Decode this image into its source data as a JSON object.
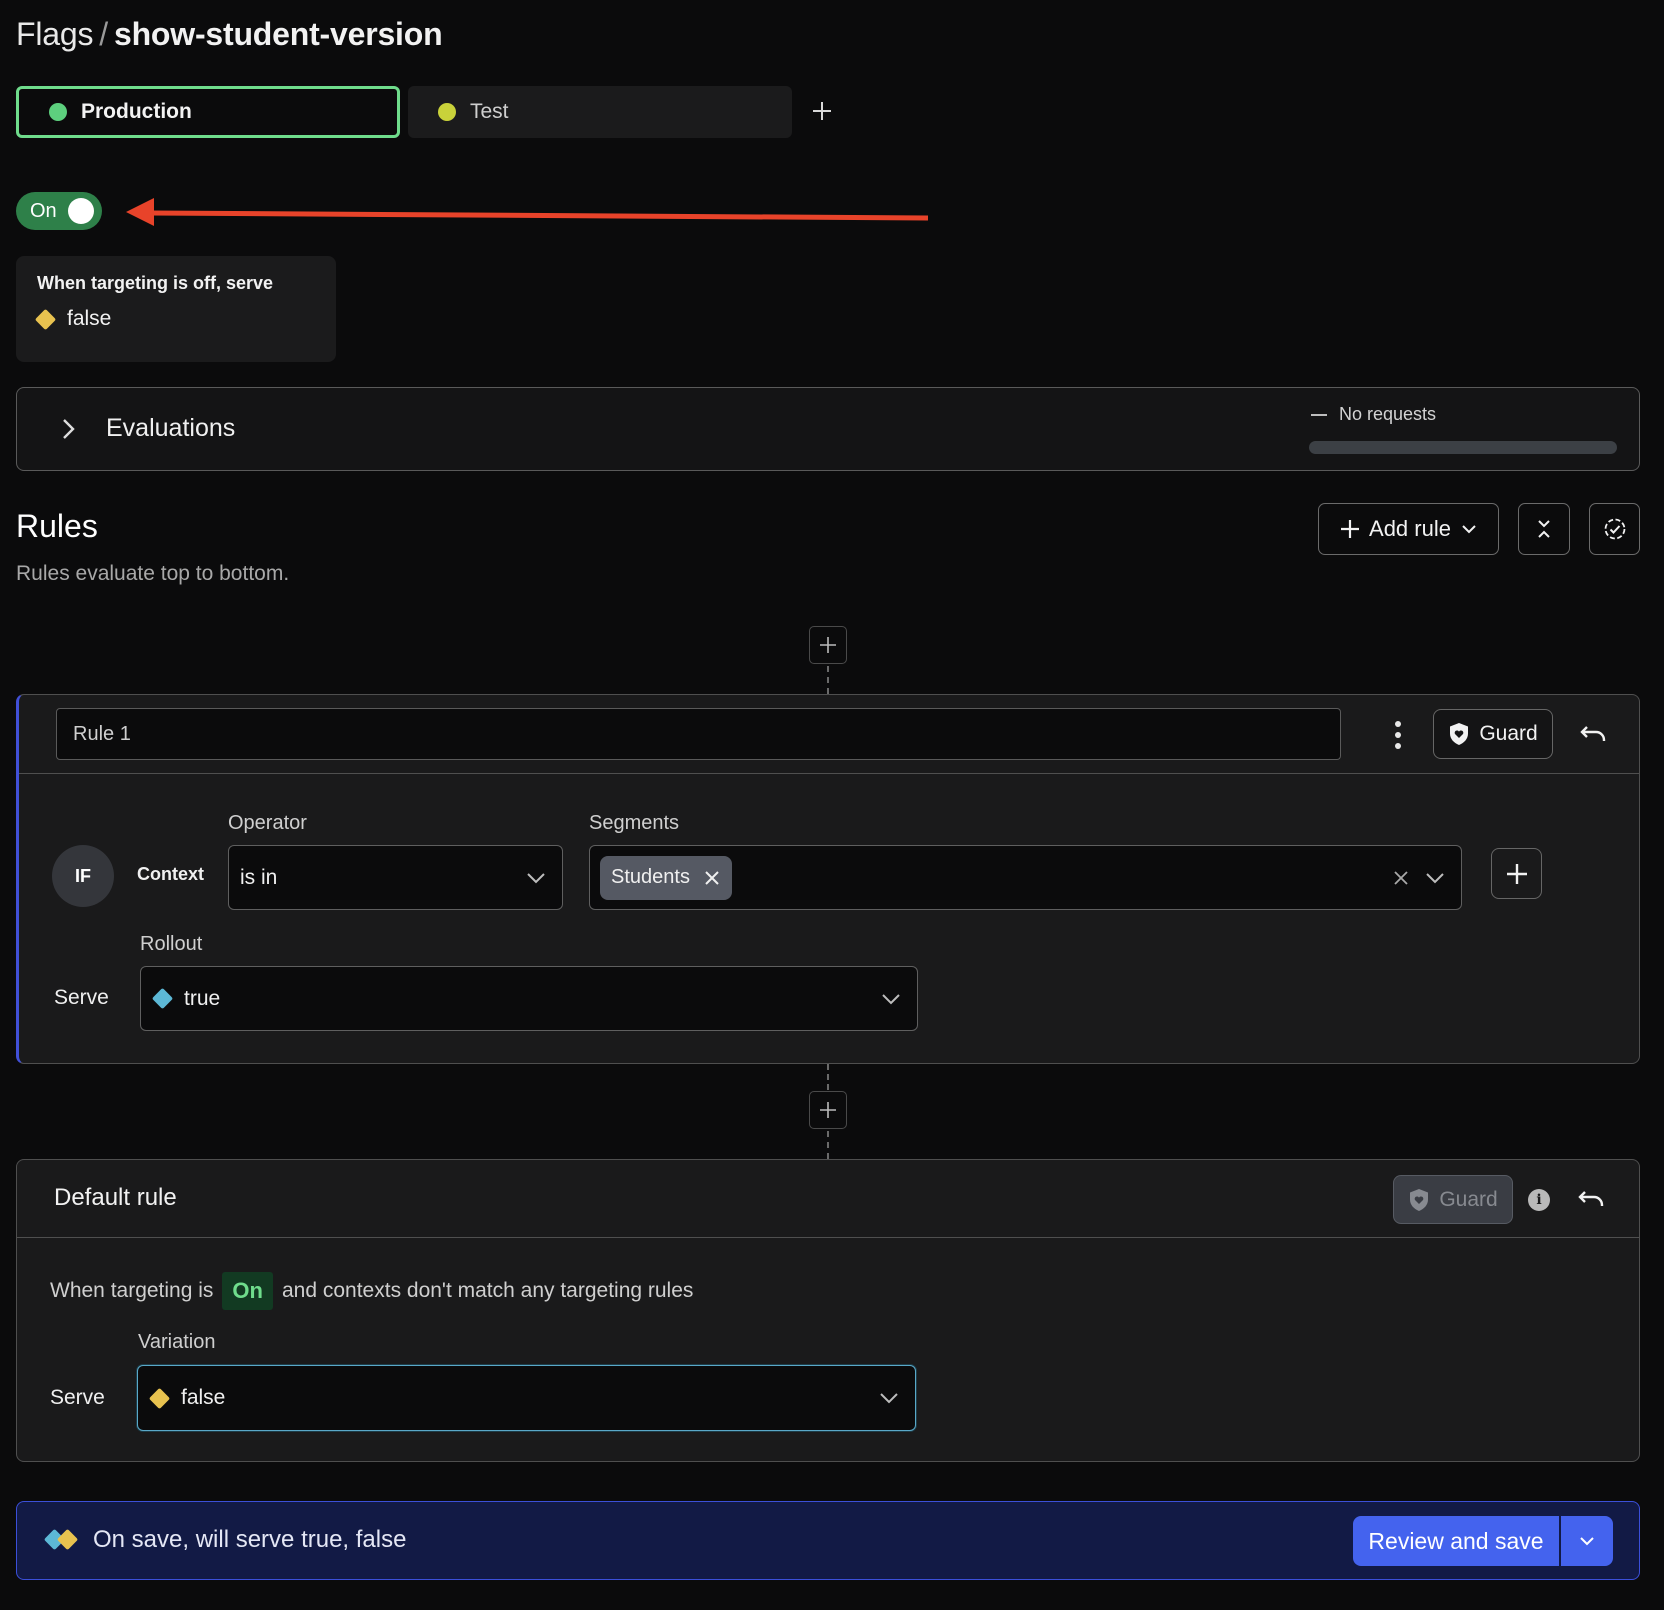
{
  "header": {
    "breadcrumb_root": "Flags",
    "separator": "/",
    "flag_key": "show-student-version"
  },
  "environments": [
    {
      "label": "Production",
      "color": "#5dd07e",
      "selected": true
    },
    {
      "label": "Test",
      "color": "#c9d23a",
      "selected": false
    }
  ],
  "add_environment_icon": "plus-icon",
  "targeting": {
    "toggle_label": "On",
    "enabled": true,
    "annotation": "red-arrow-pointing-at-toggle"
  },
  "off_serve": {
    "heading": "When targeting is off, serve",
    "variation": "false"
  },
  "evaluations": {
    "label": "Evaluations",
    "status": "No requests"
  },
  "rules": {
    "title": "Rules",
    "subtitle": "Rules evaluate top to bottom.",
    "add_rule_label": "Add rule",
    "collapse_icon": "collapse-all-icon",
    "check_icon": "dashed-check-circle-icon"
  },
  "rule1": {
    "name": "Rule 1",
    "guard_label": "Guard",
    "if_label": "IF",
    "context_label": "Context",
    "operator_label": "Operator",
    "operator_value": "is in",
    "segments_label": "Segments",
    "segments": [
      "Students"
    ],
    "rollout_label": "Rollout",
    "serve_label": "Serve",
    "serve_value": "true"
  },
  "default_rule": {
    "title": "Default rule",
    "guard_label": "Guard",
    "sentence_before": "When targeting is",
    "sentence_pill": "On",
    "sentence_after": "and contexts don't match any targeting rules",
    "variation_label": "Variation",
    "serve_label": "Serve",
    "serve_value": "false"
  },
  "save_bar": {
    "message": "On save, will serve true, false",
    "review_label": "Review and save"
  },
  "colors": {
    "true_variation": "#5cb8d6",
    "false_variation": "#e8c24f",
    "toggle_on": "#2e8049",
    "primary": "#4463ee",
    "annotation_arrow": "#e8432a"
  }
}
